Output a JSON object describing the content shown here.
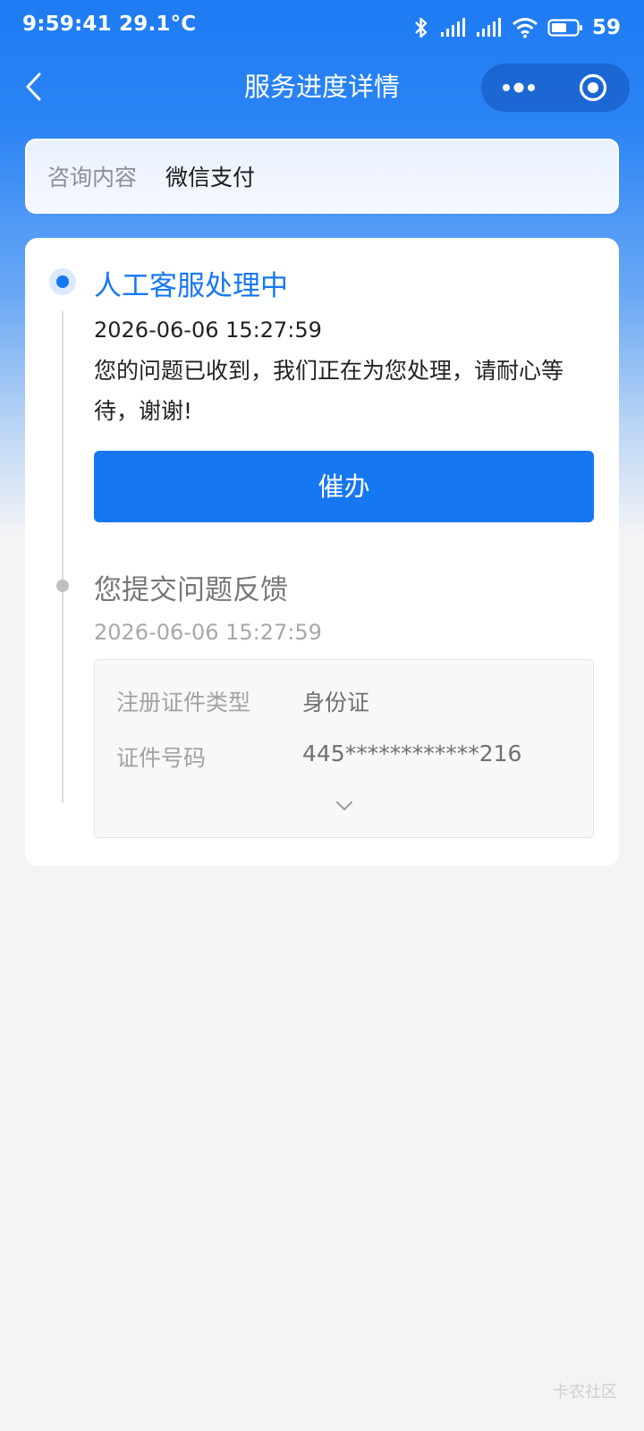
{
  "status_bar": {
    "time": "9:59:41",
    "temperature": "29.1°C",
    "battery": "59",
    "icons": [
      "bluetooth-icon",
      "signal-icon",
      "signal-icon",
      "wifi-icon",
      "battery-icon"
    ]
  },
  "nav": {
    "title": "服务进度详情",
    "back_icon": "chevron-left-icon",
    "more_icon": "more-dots-icon",
    "close_icon": "target-circle-icon"
  },
  "inquiry": {
    "label": "咨询内容",
    "value": "微信支付"
  },
  "timeline": {
    "steps": [
      {
        "title": "人工客服处理中",
        "time": "2026-06-06 15:27:59",
        "message": "您的问题已收到，我们正在为您处理，请耐心等待，谢谢!",
        "button_label": "催办",
        "status": "active"
      },
      {
        "title": "您提交问题反馈",
        "time": "2026-06-06 15:27:59",
        "status": "done",
        "details": [
          {
            "label": "注册证件类型",
            "value": "身份证"
          },
          {
            "label": "证件号码",
            "value": "445************216"
          }
        ],
        "expand_icon": "chevron-down-icon"
      }
    ]
  },
  "watermark": "卡农社区",
  "colors": {
    "primary": "#1677f3",
    "header_blue": "#1e7bf3",
    "background": "#f3f4f6"
  }
}
